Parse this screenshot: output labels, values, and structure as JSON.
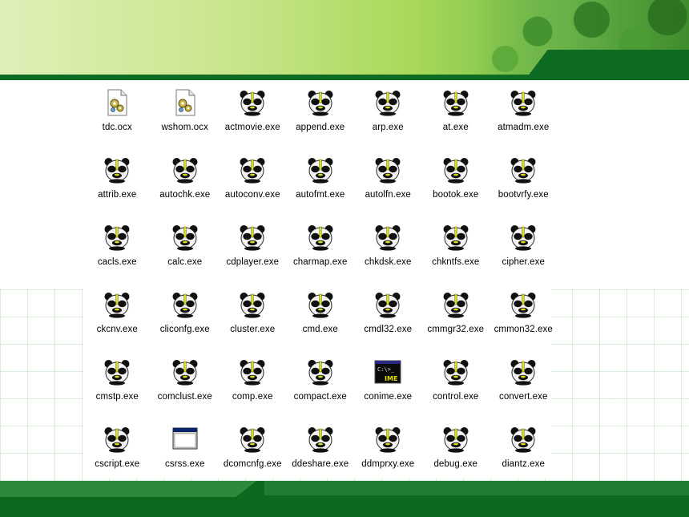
{
  "files": [
    {
      "name": "tdc.ocx",
      "icon": "ocx-file-icon"
    },
    {
      "name": "wshom.ocx",
      "icon": "ocx-file-icon"
    },
    {
      "name": "actmovie.exe",
      "icon": "panda-exe-icon"
    },
    {
      "name": "append.exe",
      "icon": "panda-exe-icon"
    },
    {
      "name": "arp.exe",
      "icon": "panda-exe-icon"
    },
    {
      "name": "at.exe",
      "icon": "panda-exe-icon"
    },
    {
      "name": "atmadm.exe",
      "icon": "panda-exe-icon"
    },
    {
      "name": "attrib.exe",
      "icon": "panda-exe-icon"
    },
    {
      "name": "autochk.exe",
      "icon": "panda-exe-icon"
    },
    {
      "name": "autoconv.exe",
      "icon": "panda-exe-icon"
    },
    {
      "name": "autofmt.exe",
      "icon": "panda-exe-icon"
    },
    {
      "name": "autolfn.exe",
      "icon": "panda-exe-icon"
    },
    {
      "name": "bootok.exe",
      "icon": "panda-exe-icon"
    },
    {
      "name": "bootvrfy.exe",
      "icon": "panda-exe-icon"
    },
    {
      "name": "cacls.exe",
      "icon": "panda-exe-icon"
    },
    {
      "name": "calc.exe",
      "icon": "panda-exe-icon"
    },
    {
      "name": "cdplayer.exe",
      "icon": "panda-exe-icon"
    },
    {
      "name": "charmap.exe",
      "icon": "panda-exe-icon"
    },
    {
      "name": "chkdsk.exe",
      "icon": "panda-exe-icon"
    },
    {
      "name": "chkntfs.exe",
      "icon": "panda-exe-icon"
    },
    {
      "name": "cipher.exe",
      "icon": "panda-exe-icon"
    },
    {
      "name": "ckcnv.exe",
      "icon": "panda-exe-icon"
    },
    {
      "name": "cliconfg.exe",
      "icon": "panda-exe-icon"
    },
    {
      "name": "cluster.exe",
      "icon": "panda-exe-icon"
    },
    {
      "name": "cmd.exe",
      "icon": "panda-exe-icon"
    },
    {
      "name": "cmdl32.exe",
      "icon": "panda-exe-icon"
    },
    {
      "name": "cmmgr32.exe",
      "icon": "panda-exe-icon"
    },
    {
      "name": "cmmon32.exe",
      "icon": "panda-exe-icon"
    },
    {
      "name": "cmstp.exe",
      "icon": "panda-exe-icon"
    },
    {
      "name": "comclust.exe",
      "icon": "panda-exe-icon"
    },
    {
      "name": "comp.exe",
      "icon": "panda-exe-icon"
    },
    {
      "name": "compact.exe",
      "icon": "panda-exe-icon"
    },
    {
      "name": "conime.exe",
      "icon": "ime-console-icon",
      "icon_text": "IME",
      "prompt_text": "C:\\>_"
    },
    {
      "name": "control.exe",
      "icon": "panda-exe-icon"
    },
    {
      "name": "convert.exe",
      "icon": "panda-exe-icon"
    },
    {
      "name": "cscript.exe",
      "icon": "panda-exe-icon"
    },
    {
      "name": "csrss.exe",
      "icon": "window-app-icon"
    },
    {
      "name": "dcomcnfg.exe",
      "icon": "panda-exe-icon"
    },
    {
      "name": "ddeshare.exe",
      "icon": "panda-exe-icon"
    },
    {
      "name": "ddmprxy.exe",
      "icon": "panda-exe-icon"
    },
    {
      "name": "debug.exe",
      "icon": "panda-exe-icon"
    },
    {
      "name": "diantz.exe",
      "icon": "panda-exe-icon"
    }
  ],
  "colors": {
    "slide_green_dark": "#0e6b22",
    "slide_green_light": "#c7e58a",
    "panda_accent": "#d6dc1e"
  }
}
